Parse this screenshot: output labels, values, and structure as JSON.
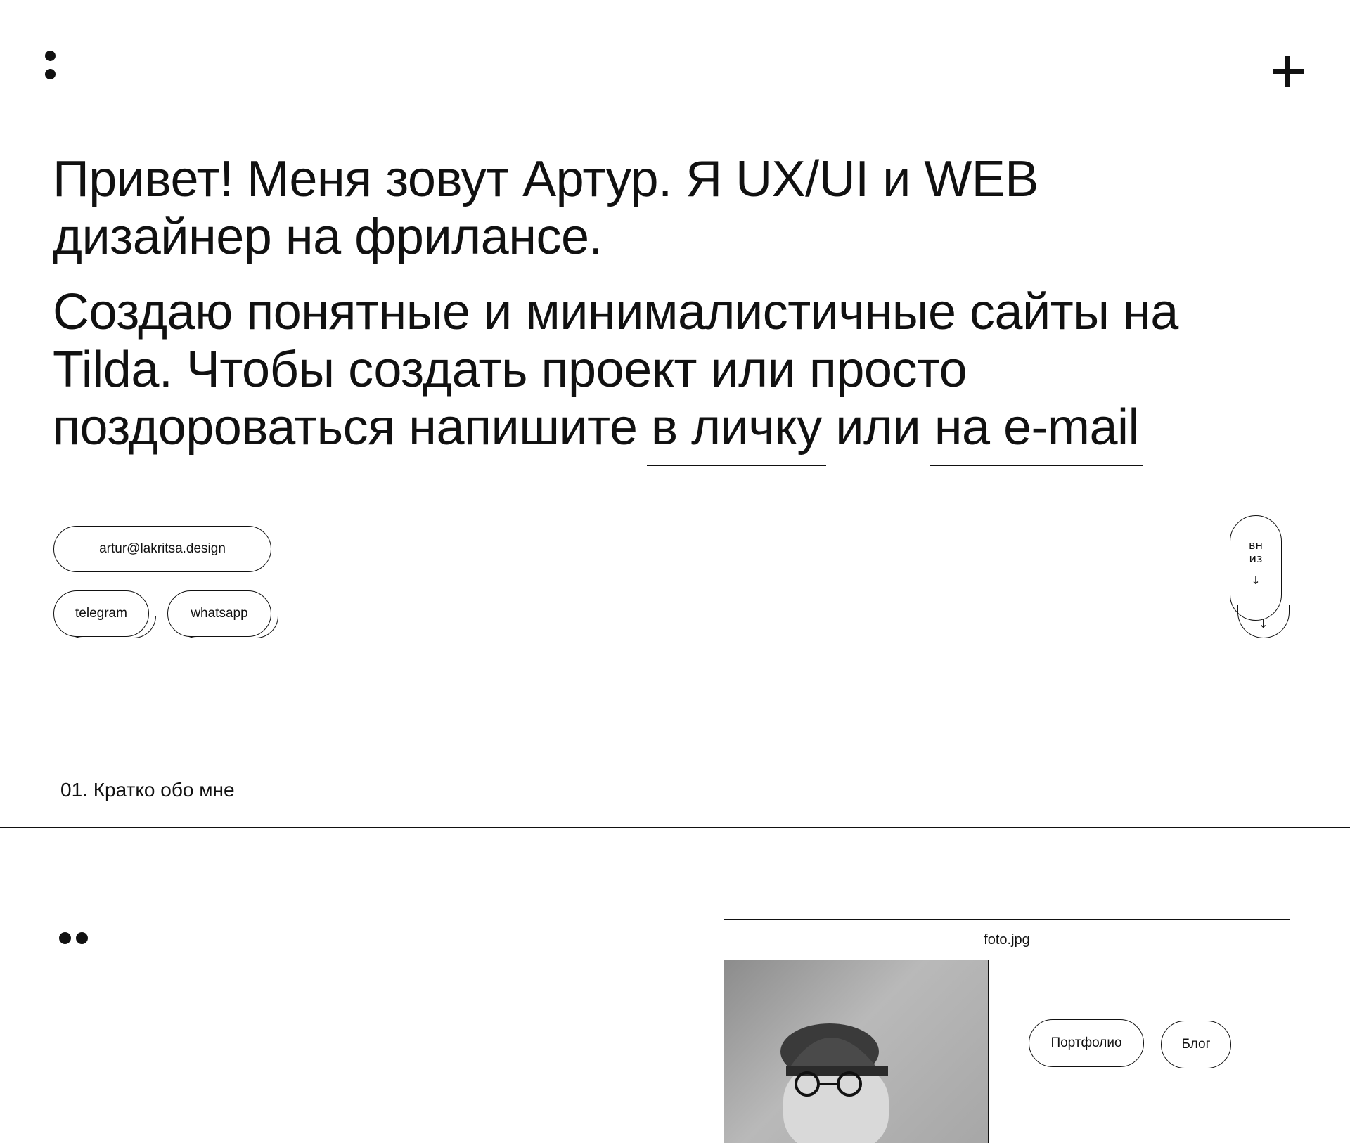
{
  "hero": {
    "line1": "Привет! Меня зовут Артур. Я UX/UI и WEB дизайнер на фрилансе.",
    "line2_start": "Создаю понятные и минималистичные сайты на Tilda. Чтобы создать проект или просто поздороваться напишите",
    "link_dm": "в личку",
    "connector": "или",
    "link_email": "на e-mail"
  },
  "contacts": {
    "email": "artur@lakritsa.design",
    "telegram": "telegram",
    "whatsapp": "whatsapp"
  },
  "scroll_down": {
    "letters": "вниз",
    "arrow": "↓"
  },
  "section": {
    "title": "01. Кратко обо мне"
  },
  "file_window": {
    "filename": "foto.jpg",
    "nav": [
      "Портфолио",
      "Блог"
    ]
  },
  "colors": {
    "text": "#111111",
    "background": "#ffffff"
  },
  "icons": {
    "menu": "vertical-dots-icon",
    "add": "plus-icon",
    "section": "two-dots-icon"
  }
}
